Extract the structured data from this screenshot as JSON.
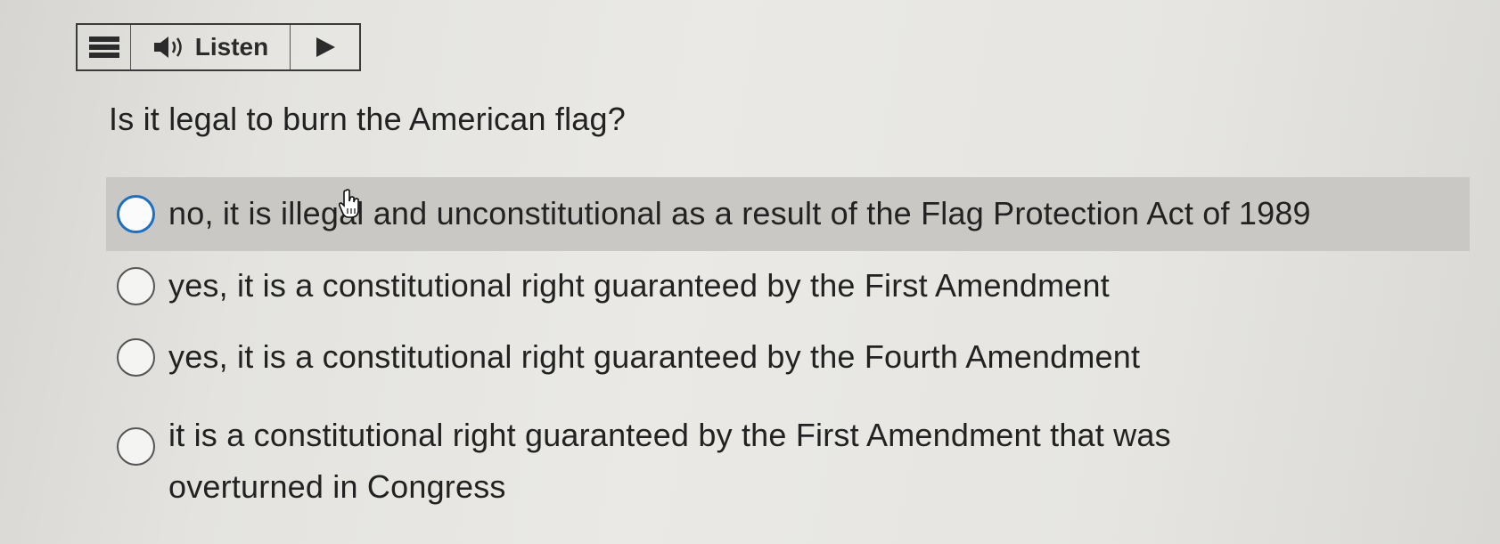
{
  "toolbar": {
    "menu_icon": "hamburger-menu-icon",
    "speaker_icon": "speaker-icon",
    "listen_label": "Listen",
    "play_icon": "play-icon"
  },
  "question": {
    "text": "Is it legal to burn the American flag?"
  },
  "options": [
    {
      "line1": "no, it is illegal and unconstitutional as a result of the Flag Protection Act of 1989",
      "line2": "",
      "selected": false,
      "hovered": true
    },
    {
      "line1": "yes, it is a constitutional right guaranteed by the First Amendment",
      "line2": "",
      "selected": false,
      "hovered": false
    },
    {
      "line1": "yes, it is a constitutional right guaranteed by the Fourth Amendment",
      "line2": "",
      "selected": false,
      "hovered": false
    },
    {
      "line1": "it is a constitutional right guaranteed by the First Amendment that was",
      "line2": "overturned in Congress",
      "selected": false,
      "hovered": false
    }
  ],
  "colors": {
    "accent": "#1f6fbf",
    "hover_background": "#c9c8c4"
  }
}
